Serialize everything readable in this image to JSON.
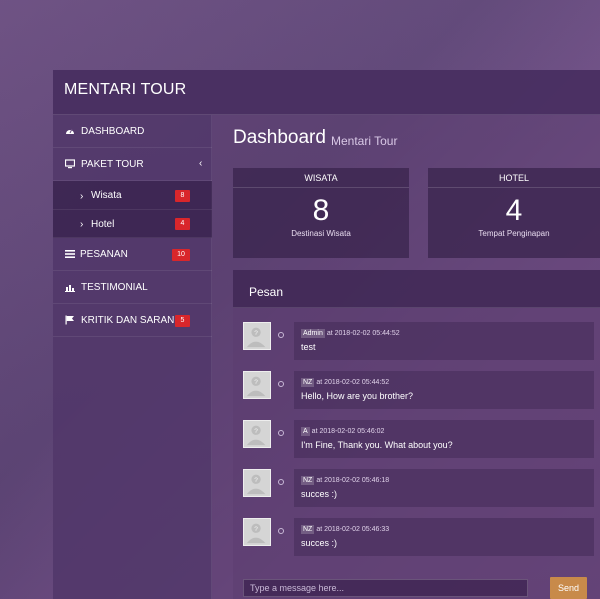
{
  "app": {
    "brand": "MENTARI TOUR"
  },
  "sidebar": {
    "items": [
      {
        "label": "DASHBOARD",
        "icon": "dashboard-icon"
      },
      {
        "label": "PAKET TOUR",
        "icon": "monitor-icon"
      },
      {
        "label": "Wisata",
        "badge": "8"
      },
      {
        "label": "Hotel",
        "badge": "4"
      },
      {
        "label": "PESANAN",
        "icon": "list-icon",
        "badge": "10"
      },
      {
        "label": "TESTIMONIAL",
        "icon": "chart-icon"
      },
      {
        "label": "KRITIK DAN SARAN",
        "icon": "flag-icon",
        "badge": "5"
      }
    ]
  },
  "main": {
    "title": "Dashboard",
    "subtitle": "Mentari Tour",
    "stats": [
      {
        "title": "WISATA",
        "value": "8",
        "caption": "Destinasi Wisata"
      },
      {
        "title": "HOTEL",
        "value": "4",
        "caption": "Tempat Penginapan"
      }
    ],
    "chat": {
      "title": "Pesan",
      "messages": [
        {
          "tag": "Admin",
          "time": "at 2018-02-02 05:44:52",
          "text": "test"
        },
        {
          "tag": "NZ",
          "time": "at 2018-02-02 05:44:52",
          "text": "Hello, How are you brother?"
        },
        {
          "tag": "A",
          "time": "at 2018-02-02 05:46:02",
          "text": "I'm Fine, Thank you. What about you?"
        },
        {
          "tag": "NZ",
          "time": "at 2018-02-02 05:46:18",
          "text": "succes :)"
        },
        {
          "tag": "NZ",
          "time": "at 2018-02-02 05:46:33",
          "text": "succes :)"
        }
      ],
      "placeholder": "Type a message here...",
      "send_label": "Send"
    }
  },
  "colors": {
    "badge": "#d9262b",
    "send": "#c88a4a"
  }
}
